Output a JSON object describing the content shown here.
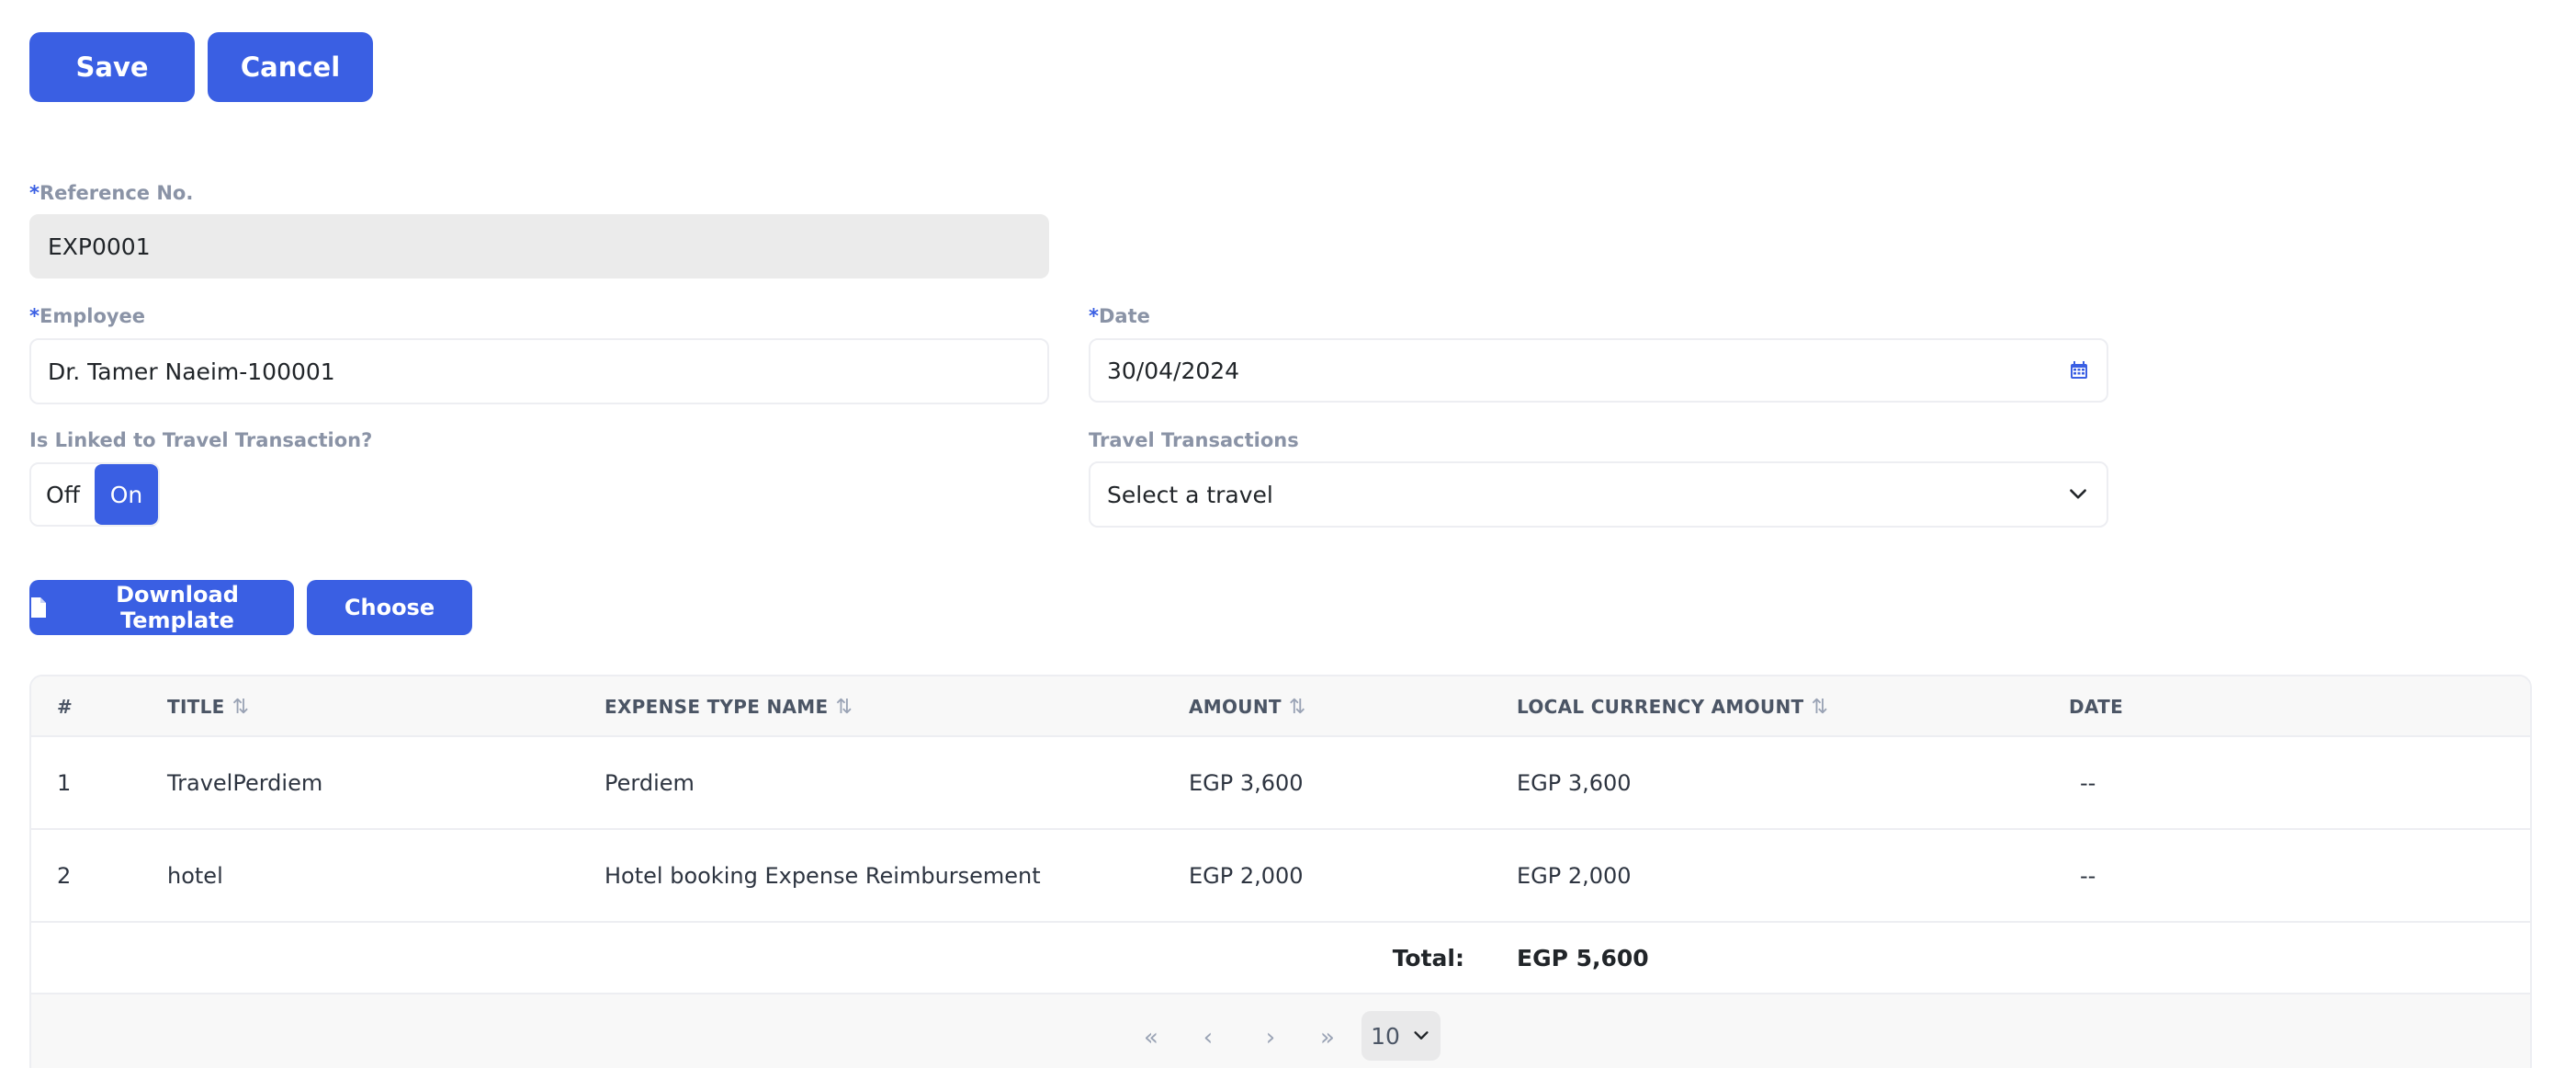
{
  "toolbar": {
    "save_label": "Save",
    "cancel_label": "Cancel"
  },
  "form": {
    "reference": {
      "label": "Reference No.",
      "value": "EXP0001"
    },
    "employee": {
      "label": "Employee",
      "value": "Dr. Tamer  Naeim-100001"
    },
    "date": {
      "label": "Date",
      "value": "30/04/2024"
    },
    "linked_travel": {
      "label": "Is Linked to Travel Transaction?",
      "off_label": "Off",
      "on_label": "On",
      "selected": "On"
    },
    "travel_transactions": {
      "label": "Travel Transactions",
      "value": "Select a travel"
    },
    "required_mark": "*"
  },
  "actions": {
    "download_label": "Download Template",
    "choose_label": "Choose"
  },
  "table": {
    "columns": [
      "#",
      "TITLE",
      "EXPENSE TYPE NAME",
      "AMOUNT",
      "LOCAL CURRENCY AMOUNT",
      "DATE"
    ],
    "rows": [
      {
        "index": "1",
        "title": "TravelPerdiem",
        "expense_type": "Perdiem",
        "amount": "EGP 3,600",
        "local_amount": "EGP 3,600",
        "date": "--"
      },
      {
        "index": "2",
        "title": "hotel",
        "expense_type": "Hotel booking Expense Reimbursement",
        "amount": "EGP 2,000",
        "local_amount": "EGP 2,000",
        "date": "--"
      }
    ],
    "total_label": "Total:",
    "total_value": "EGP 5,600"
  },
  "pagination": {
    "first": "«",
    "prev": "‹",
    "next": "›",
    "last": "»",
    "page_size": "10"
  },
  "colors": {
    "primary": "#3a5fe3",
    "label": "#8a93a6",
    "disabled_bg": "#ebebeb"
  }
}
